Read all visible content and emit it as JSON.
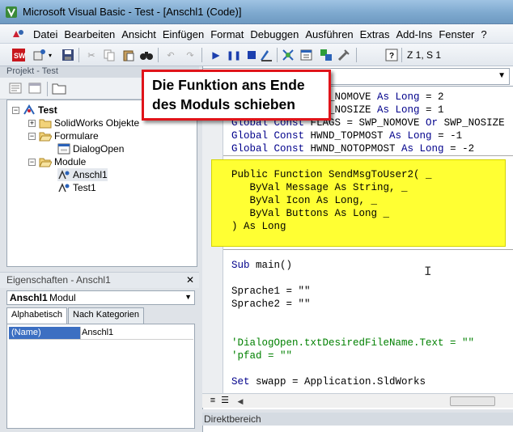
{
  "window": {
    "title": "Microsoft Visual Basic - Test - [Anschl1 (Code)]"
  },
  "menubar": {
    "items": [
      "Datei",
      "Bearbeiten",
      "Ansicht",
      "Einfügen",
      "Format",
      "Debuggen",
      "Ausführen",
      "Extras",
      "Add-Ins",
      "Fenster",
      "?"
    ]
  },
  "toolbar": {
    "cursor_position": "Z 1, S 1"
  },
  "project_panel": {
    "title": "Projekt - Test",
    "tree": {
      "root": "Test",
      "folders": [
        {
          "label": "SolidWorks Objekte",
          "expanded": false,
          "children": []
        },
        {
          "label": "Formulare",
          "expanded": true,
          "children": [
            "DialogOpen"
          ]
        },
        {
          "label": "Module",
          "expanded": true,
          "children": [
            "Anschl1",
            "Test1"
          ]
        }
      ]
    }
  },
  "properties_panel": {
    "title": "Eigenschaften - Anschl1",
    "object_name": "Anschl1",
    "object_type": "Modul",
    "tabs": [
      "Alphabetisch",
      "Nach Kategorien"
    ],
    "rows": [
      {
        "name": "(Name)",
        "value": "Anschl1"
      }
    ]
  },
  "code": {
    "lines_top": [
      "Global Const SWP_NOMOVE As Long = 2",
      "Global Const SWP_NOSIZE As Long = 1",
      "Global Const FLAGS = SWP_NOMOVE Or SWP_NOSIZE",
      "Global Const HWND_TOPMOST As Long = -1",
      "Global Const HWND_NOTOPMOST As Long = -2"
    ],
    "function_block": [
      "Public Function SendMsgToUser2( _",
      "   ByVal Message As String, _",
      "   ByVal Icon As Long, _",
      "   ByVal Buttons As Long _",
      ") As Long"
    ],
    "main_lines": [
      "Sub main()",
      "Sprache1 = \"\"",
      "Sprache2 = \"\"",
      "'DialogOpen.txtDesiredFileName.Text = \"\"",
      "'pfad = \"\"",
      "Set swapp = Application.SldWorks"
    ]
  },
  "immediate_window": {
    "title": "Direktbereich"
  },
  "callout": {
    "line1": "Die Funktion ans Ende",
    "line2": "des Moduls schieben",
    "border_color": "#e0141a"
  },
  "colors": {
    "keyword": "#00008b",
    "comment": "#008000",
    "highlight": "#ffff33"
  }
}
